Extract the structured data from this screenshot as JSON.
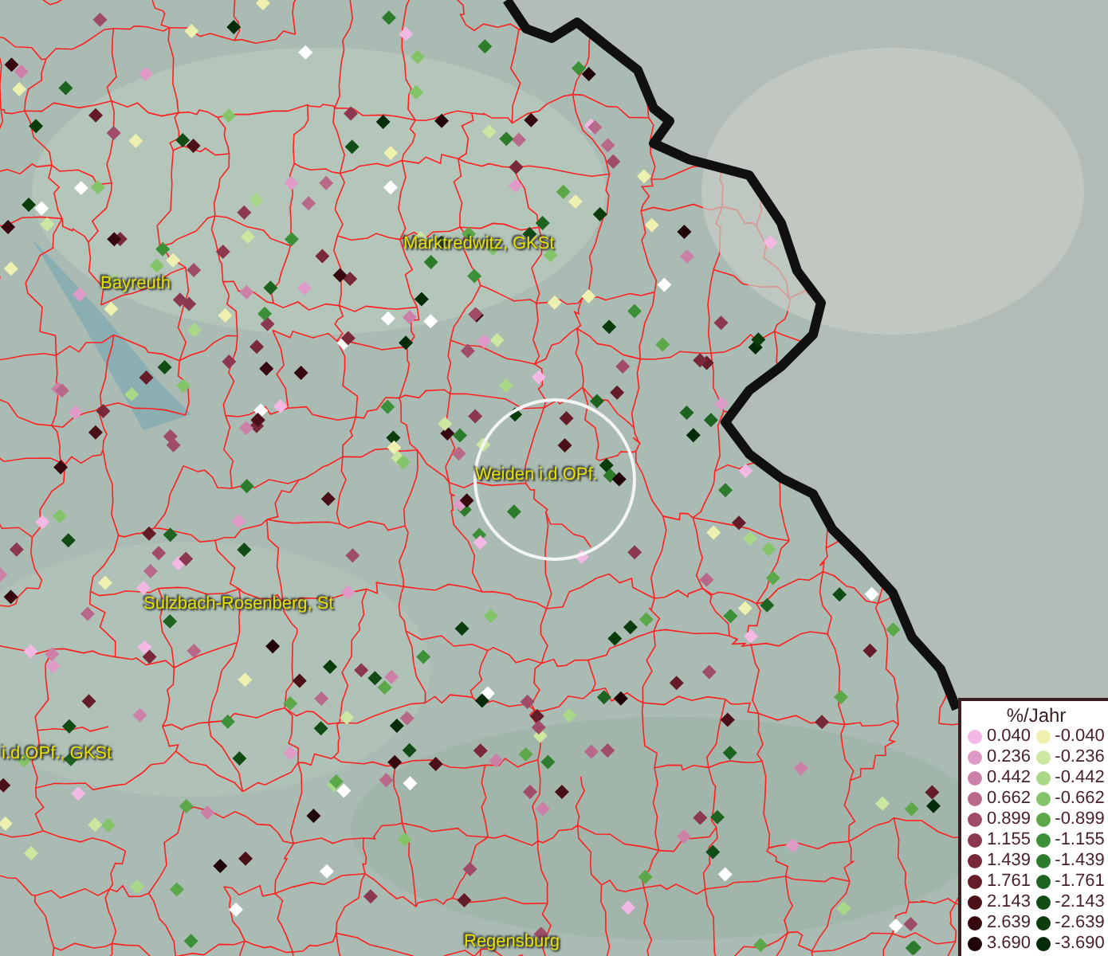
{
  "map": {
    "places": [
      {
        "name": "Marktredwitz, GKSt"
      },
      {
        "name": "Bayreuth"
      },
      {
        "name": "Weiden i.d.OPf."
      },
      {
        "name": "Sulzbach-Rosenberg, St"
      },
      {
        "name": "i.d.OPf., GKSt"
      },
      {
        "name": "Regensburg"
      }
    ]
  },
  "legend": {
    "title": "%/Jahr",
    "positive": [
      {
        "value": "0.040",
        "color": "#f4b8e4"
      },
      {
        "value": "0.236",
        "color": "#e09ac8"
      },
      {
        "value": "0.442",
        "color": "#cc80a8"
      },
      {
        "value": "0.662",
        "color": "#b86888"
      },
      {
        "value": "0.899",
        "color": "#a04c68"
      },
      {
        "value": "1.155",
        "color": "#8c3850"
      },
      {
        "value": "1.439",
        "color": "#782838"
      },
      {
        "value": "1.761",
        "color": "#641c28"
      },
      {
        "value": "2.143",
        "color": "#4c1018"
      },
      {
        "value": "2.639",
        "color": "#380810"
      },
      {
        "value": "3.690",
        "color": "#200408"
      }
    ],
    "negative": [
      {
        "value": "-0.040",
        "color": "#eef0b0"
      },
      {
        "value": "-0.236",
        "color": "#cce8a0"
      },
      {
        "value": "-0.442",
        "color": "#a8d888"
      },
      {
        "value": "-0.662",
        "color": "#84c468"
      },
      {
        "value": "-0.899",
        "color": "#5ca848"
      },
      {
        "value": "-1.155",
        "color": "#3c9038"
      },
      {
        "value": "-1.439",
        "color": "#2c7c2c"
      },
      {
        "value": "-1.761",
        "color": "#1c6420"
      },
      {
        "value": "-2.143",
        "color": "#104c14"
      },
      {
        "value": "-2.639",
        "color": "#0a3c0c"
      },
      {
        "value": "-3.690",
        "color": "#042c08"
      }
    ]
  }
}
